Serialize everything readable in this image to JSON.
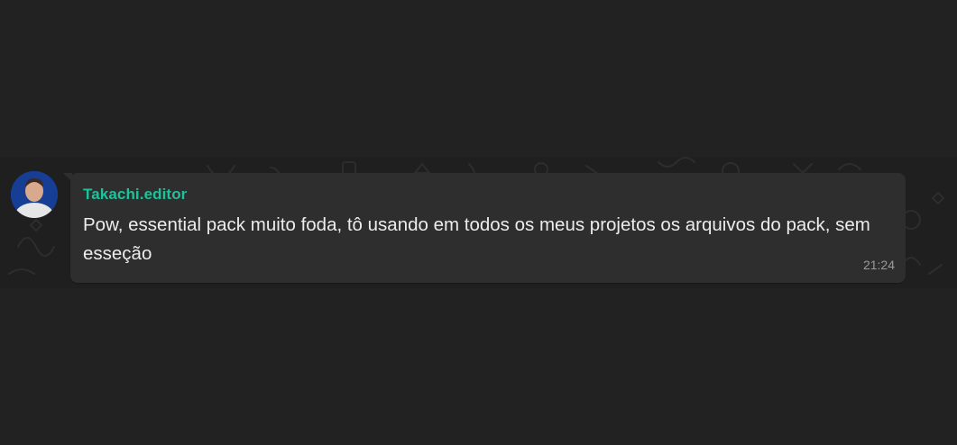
{
  "message": {
    "sender": "Takachi.editor",
    "text": "Pow, essential pack muito foda, tô usando em todos os meus projetos os arquivos do pack, sem esseção",
    "time": "21:24"
  },
  "colors": {
    "background": "#222222",
    "bubble": "#2e2e2e",
    "sender_name": "#1ec29a",
    "message_text": "#ececec",
    "timestamp": "#9b9b9b"
  },
  "icons": {
    "avatar": "user-avatar-photo"
  }
}
